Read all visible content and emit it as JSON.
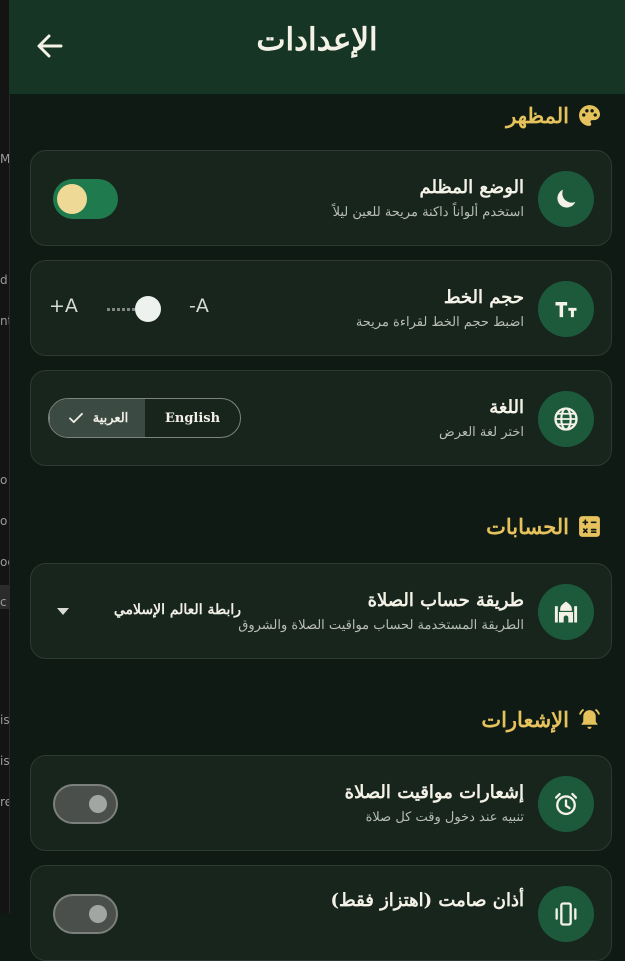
{
  "header": {
    "title": "الإعدادات"
  },
  "background_window": {
    "fragments": [
      "M",
      "d",
      "nt",
      "o",
      "o",
      "oc",
      "c",
      "is",
      "is",
      "re"
    ]
  },
  "sections": {
    "appearance": {
      "title": "المظهر",
      "dark_mode": {
        "title": "الوضع المظلم",
        "subtitle": "استخدم ألواناً داكنة مريحة للعين ليلاً",
        "on": true
      },
      "font_size": {
        "title": "حجم الخط",
        "subtitle": "اضبط حجم الخط لقراءة مريحة",
        "increase_label": "A+",
        "decrease_label": "A-"
      },
      "language": {
        "title": "اللغة",
        "subtitle": "اختر لغة العرض",
        "options": [
          "العربية",
          "English"
        ],
        "selected": "العربية"
      }
    },
    "calculations": {
      "title": "الحسابات",
      "method": {
        "title": "طريقة حساب الصلاة",
        "subtitle": "الطريقة المستخدمة لحساب مواقيت الصلاة والشروق",
        "value": "رابطة العالم الإسلامي"
      }
    },
    "notifications": {
      "title": "الإشعارات",
      "prayer_alerts": {
        "title": "إشعارات مواقيت الصلاة",
        "subtitle": "تنبيه عند دخول وقت كل صلاة",
        "on": false
      },
      "silent_adhan": {
        "title": "أذان صامت (اهتزاز فقط)",
        "on": false
      }
    }
  },
  "colors": {
    "accent_gold": "#e6c25c",
    "icon_bg": "#1d5a3c",
    "header_bg": "#163524",
    "toggle_on": "#1f7a4e"
  }
}
